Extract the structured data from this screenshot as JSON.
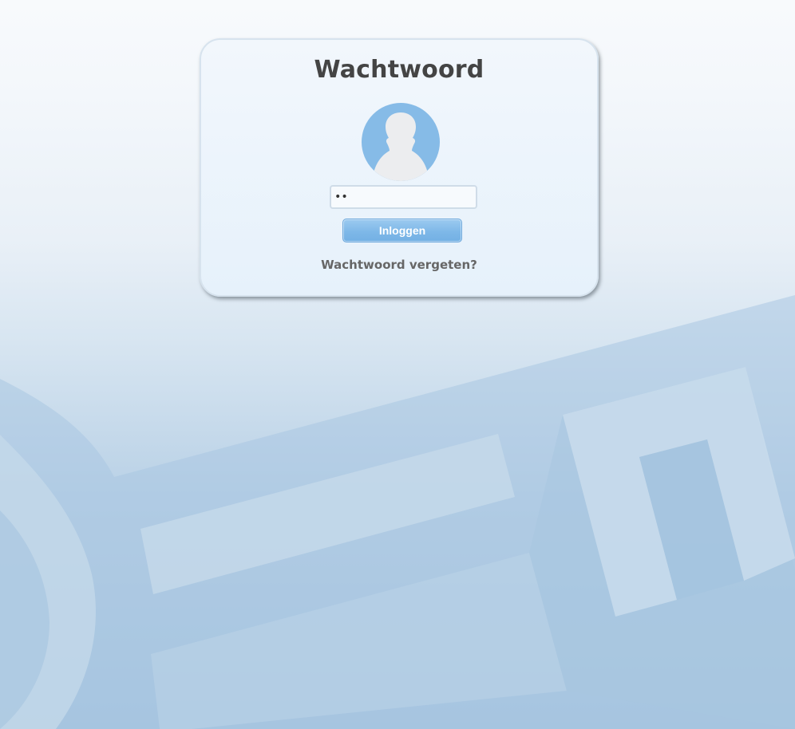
{
  "login": {
    "title": "Wachtwoord",
    "avatar_icon": "user-avatar-icon",
    "password_value": "••",
    "button_label": "Inloggen",
    "forgot_link": "Wachtwoord vergeten?"
  },
  "background": {
    "watermark_icon": "key-icon"
  },
  "colors": {
    "accent": "#86bbe7",
    "button": "#7eb8e8",
    "title_text": "#444444",
    "link_text": "#666666"
  }
}
